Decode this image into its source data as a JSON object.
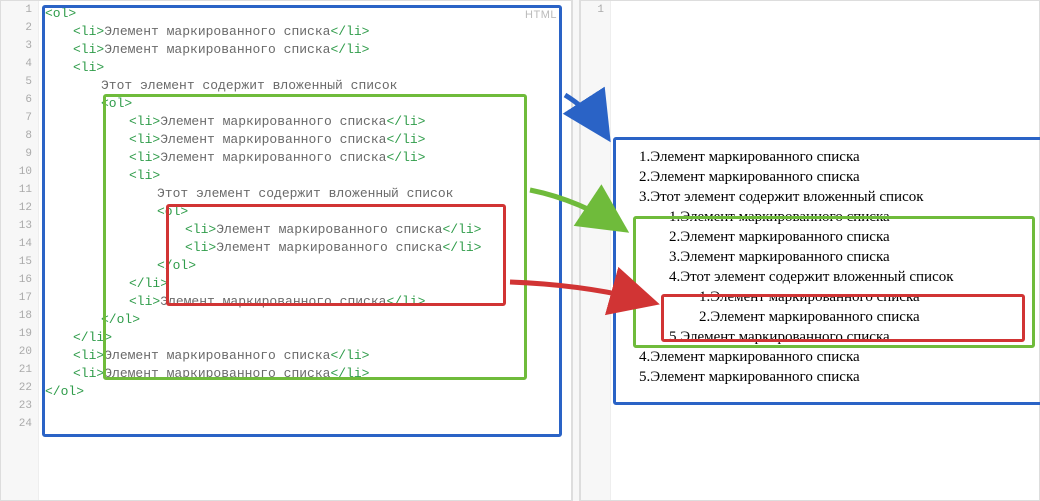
{
  "code": {
    "lang_label": "HTML",
    "lines": [
      {
        "n": 1,
        "ind": 0,
        "parts": [
          {
            "t": "tag",
            "v": "<ol>"
          }
        ]
      },
      {
        "n": 2,
        "ind": 28,
        "parts": [
          {
            "t": "tag",
            "v": "<li>"
          },
          {
            "t": "txt",
            "v": "Элемент маркированного списка"
          },
          {
            "t": "tag",
            "v": "</li>"
          }
        ]
      },
      {
        "n": 3,
        "ind": 28,
        "parts": [
          {
            "t": "tag",
            "v": "<li>"
          },
          {
            "t": "txt",
            "v": "Элемент маркированного списка"
          },
          {
            "t": "tag",
            "v": "</li>"
          }
        ]
      },
      {
        "n": 4,
        "ind": 28,
        "parts": [
          {
            "t": "tag",
            "v": "<li>"
          }
        ]
      },
      {
        "n": 5,
        "ind": 56,
        "parts": [
          {
            "t": "txt",
            "v": "Этот элемент содержит вложенный список"
          }
        ]
      },
      {
        "n": 6,
        "ind": 56,
        "parts": [
          {
            "t": "tag",
            "v": "<ol>"
          }
        ]
      },
      {
        "n": 7,
        "ind": 84,
        "parts": [
          {
            "t": "tag",
            "v": "<li>"
          },
          {
            "t": "txt",
            "v": "Элемент маркированного списка"
          },
          {
            "t": "tag",
            "v": "</li>"
          }
        ]
      },
      {
        "n": 8,
        "ind": 84,
        "parts": [
          {
            "t": "tag",
            "v": "<li>"
          },
          {
            "t": "txt",
            "v": "Элемент маркированного списка"
          },
          {
            "t": "tag",
            "v": "</li>"
          }
        ]
      },
      {
        "n": 9,
        "ind": 84,
        "parts": [
          {
            "t": "tag",
            "v": "<li>"
          },
          {
            "t": "txt",
            "v": "Элемент маркированного списка"
          },
          {
            "t": "tag",
            "v": "</li>"
          }
        ]
      },
      {
        "n": 10,
        "ind": 84,
        "parts": [
          {
            "t": "tag",
            "v": "<li>"
          }
        ]
      },
      {
        "n": 11,
        "ind": 112,
        "parts": [
          {
            "t": "txt",
            "v": "Этот элемент содержит вложенный список"
          }
        ]
      },
      {
        "n": 12,
        "ind": 112,
        "parts": [
          {
            "t": "tag",
            "v": "<ol>"
          }
        ]
      },
      {
        "n": 13,
        "ind": 140,
        "parts": [
          {
            "t": "tag",
            "v": "<li>"
          },
          {
            "t": "txt",
            "v": "Элемент маркированного списка"
          },
          {
            "t": "tag",
            "v": "</li>"
          }
        ]
      },
      {
        "n": 14,
        "ind": 140,
        "parts": [
          {
            "t": "tag",
            "v": "<li>"
          },
          {
            "t": "txt",
            "v": "Элемент маркированного списка"
          },
          {
            "t": "tag",
            "v": "</li>"
          }
        ]
      },
      {
        "n": 15,
        "ind": 112,
        "parts": [
          {
            "t": "tag",
            "v": "</ol>"
          }
        ]
      },
      {
        "n": 16,
        "ind": 84,
        "parts": [
          {
            "t": "tag",
            "v": "</li>"
          }
        ]
      },
      {
        "n": 17,
        "ind": 84,
        "parts": [
          {
            "t": "tag",
            "v": "<li>"
          },
          {
            "t": "txt",
            "v": "Элемент маркированного списка"
          },
          {
            "t": "tag",
            "v": "</li>"
          }
        ]
      },
      {
        "n": 18,
        "ind": 56,
        "parts": [
          {
            "t": "tag",
            "v": "</ol>"
          }
        ]
      },
      {
        "n": 19,
        "ind": 28,
        "parts": [
          {
            "t": "tag",
            "v": "</li>"
          }
        ]
      },
      {
        "n": 20,
        "ind": 28,
        "parts": [
          {
            "t": "tag",
            "v": "<li>"
          },
          {
            "t": "txt",
            "v": "Элемент маркированного списка"
          },
          {
            "t": "tag",
            "v": "</li>"
          }
        ]
      },
      {
        "n": 21,
        "ind": 28,
        "parts": [
          {
            "t": "tag",
            "v": "<li>"
          },
          {
            "t": "txt",
            "v": "Элемент маркированного списка"
          },
          {
            "t": "tag",
            "v": "</li>"
          }
        ]
      },
      {
        "n": 22,
        "ind": 0,
        "parts": [
          {
            "t": "tag",
            "v": "</ol>"
          }
        ]
      }
    ]
  },
  "render": {
    "items": [
      {
        "num": "1.",
        "text": "Элемент маркированного списка",
        "cls": "indent1"
      },
      {
        "num": "2.",
        "text": "Элемент маркированного списка",
        "cls": "indent1"
      },
      {
        "num": "3.",
        "text": "Этот элемент содержит вложенный список",
        "cls": "indent1"
      },
      {
        "num": "1.",
        "text": "Элемент маркированного списка",
        "cls": "indent2"
      },
      {
        "num": "2.",
        "text": "Элемент маркированного списка",
        "cls": "indent2"
      },
      {
        "num": "3.",
        "text": "Элемент маркированного списка",
        "cls": "indent2"
      },
      {
        "num": "4.",
        "text": "Этот элемент содержит вложенный список",
        "cls": "indent2"
      },
      {
        "num": "1.",
        "text": "Элемент маркированного списка",
        "cls": "indent3"
      },
      {
        "num": "2.",
        "text": "Элемент маркированного списка",
        "cls": "indent3"
      },
      {
        "num": "5.",
        "text": "Элемент маркированного списка",
        "cls": "indent2"
      },
      {
        "num": "4.",
        "text": "Элемент маркированного списка",
        "cls": "indent1"
      },
      {
        "num": "5.",
        "text": "Элемент маркированного списка",
        "cls": "indent1"
      }
    ]
  },
  "right_gutter": {
    "line_number": "1"
  },
  "colors": {
    "blue": "#2a63c6",
    "green": "#6fbb3b",
    "red": "#d13434"
  }
}
